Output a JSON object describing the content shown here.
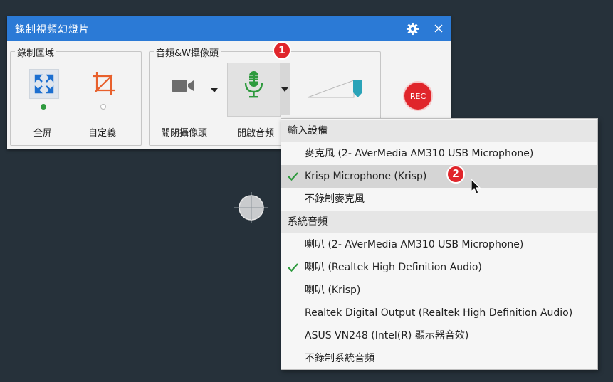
{
  "window": {
    "title": "錄制視頻幻燈片",
    "groups": {
      "area": {
        "label": "錄制區域",
        "fullscreen_label": "全屏",
        "custom_label": "自定義"
      },
      "av": {
        "label": "音頻&W攝像頭",
        "camera_label": "關閉攝像頭",
        "audio_label": "開啟音頻"
      }
    },
    "rec_label": "REC"
  },
  "annotations": {
    "badge1": "1",
    "badge2": "2"
  },
  "menu": {
    "input_header": "輸入設備",
    "input_items": [
      {
        "label": "麥克風 (2- AVerMedia AM310 USB Microphone)",
        "checked": false
      },
      {
        "label": "Krisp Microphone (Krisp)",
        "checked": true
      },
      {
        "label": "不錄制麥克風",
        "checked": false
      }
    ],
    "system_header": "系統音頻",
    "system_items": [
      {
        "label": "喇叭 (2- AVerMedia AM310 USB Microphone)",
        "checked": false
      },
      {
        "label": "喇叭 (Realtek High Definition Audio)",
        "checked": true
      },
      {
        "label": "喇叭 (Krisp)",
        "checked": false
      },
      {
        "label": "Realtek Digital Output (Realtek High Definition Audio)",
        "checked": false
      },
      {
        "label": "ASUS VN248 (Intel(R) 顯示器音效)",
        "checked": false
      },
      {
        "label": "不錄制系統音頻",
        "checked": false
      }
    ]
  },
  "colors": {
    "titlebar": "#2b7ad6",
    "accent_check": "#2e9a3e",
    "rec": "#e0252b",
    "mic_green": "#2e9a3e",
    "crop_orange": "#e8602c",
    "volume_teal": "#2aa3b8"
  }
}
